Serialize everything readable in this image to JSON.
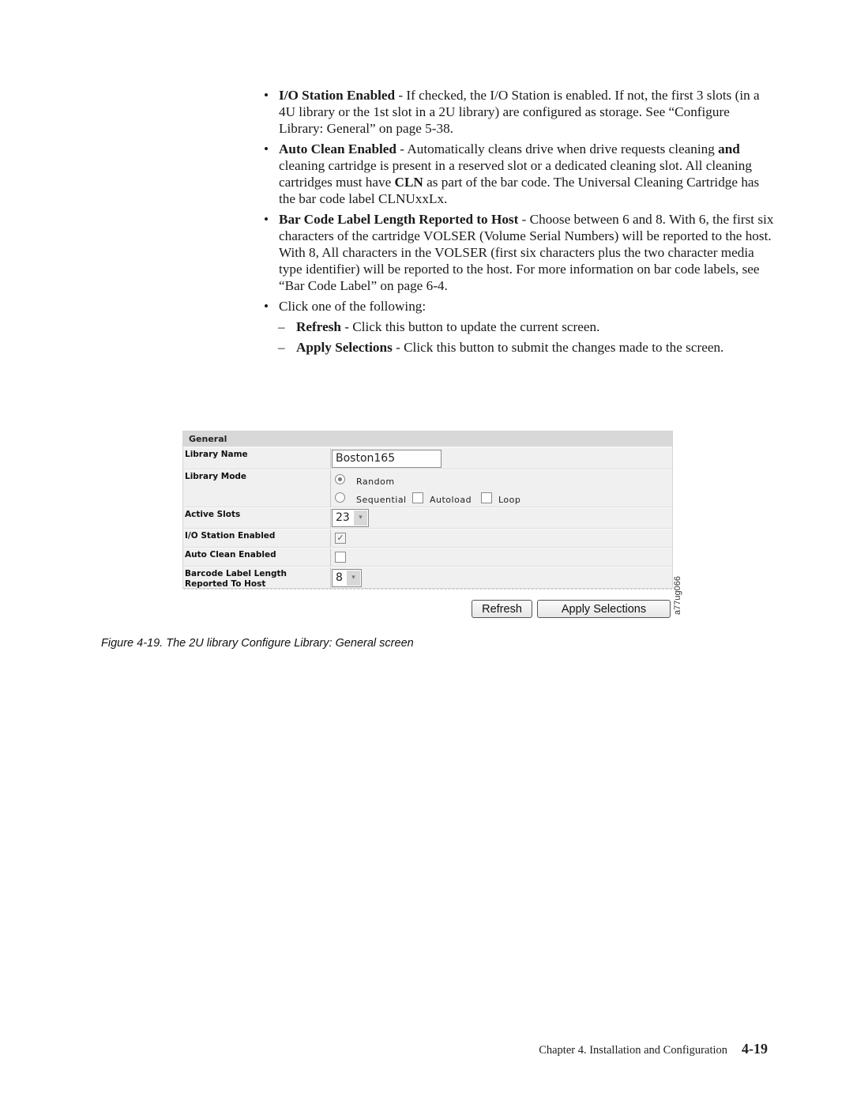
{
  "body": {
    "bullets": [
      {
        "term": "I/O Station Enabled",
        "text": " - If checked, the I/O Station is enabled. If not, the first 3 slots (in a 4U library or the 1st slot in a 2U library) are configured as storage. See “Configure Library: General” on page 5-38."
      },
      {
        "term": "Auto Clean Enabled",
        "text_a": " - Automatically cleans drive when drive requests cleaning ",
        "bold_and": "and",
        "text_b": " cleaning cartridge is present in a reserved slot or a dedicated cleaning slot. All cleaning cartridges must have ",
        "bold_cln": "CLN",
        "text_c": " as part of the bar code. The Universal Cleaning Cartridge has the bar code label CLNUxxLx."
      },
      {
        "term": "Bar Code Label Length Reported to Host",
        "text": " - Choose between 6 and 8. With 6, the first six characters of the cartridge VOLSER (Volume Serial Numbers) will be reported to the host. With 8, All characters in the VOLSER (first six characters plus the two character media type identifier) will be reported to the host. For more information on bar code labels, see “Bar Code Label” on page 6-4."
      },
      {
        "text": "Click one of the following:"
      }
    ],
    "sub_items": [
      {
        "term": "Refresh",
        "text": " - Click this button to update the current screen."
      },
      {
        "term": "Apply Selections",
        "text": " - Click this button to submit the changes made to the screen."
      }
    ],
    "bullet_glyph": "•",
    "dash_glyph": "–"
  },
  "screenshot": {
    "section_header": "General",
    "fields": {
      "library_name_label": "Library Name",
      "library_name_value": "Boston165",
      "library_mode_label": "Library Mode",
      "mode_random": "Random",
      "mode_sequential": "Sequential",
      "autoload": "Autoload",
      "loop": "Loop",
      "selected_mode": "Random",
      "active_slots_label": "Active Slots",
      "active_slots_value": "23",
      "io_station_label": "I/O Station Enabled",
      "io_station_checked": true,
      "auto_clean_label": "Auto Clean Enabled",
      "auto_clean_checked": false,
      "barcode_label_line1": "Barcode Label Length",
      "barcode_label_line2": "Reported To Host",
      "barcode_value": "8"
    },
    "buttons": {
      "refresh": "Refresh",
      "apply": "Apply Selections"
    },
    "figure_id": "a77ug066",
    "check_glyph": "✓",
    "dropdown_glyph": "▾"
  },
  "caption": "Figure 4-19. The 2U library Configure Library: General screen",
  "footer": {
    "chapter": "Chapter 4. Installation and Configuration",
    "page": "4-19"
  }
}
